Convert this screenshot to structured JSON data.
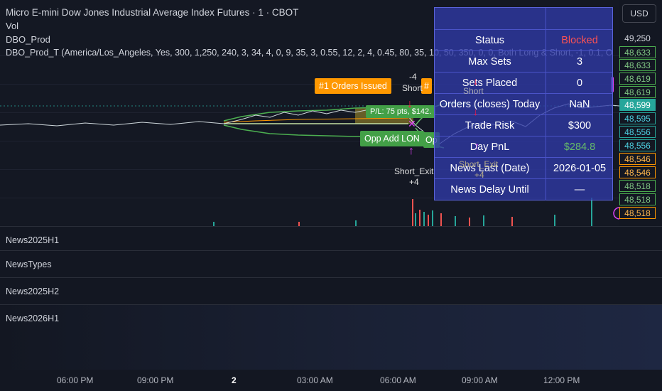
{
  "header": {
    "title": "Micro E-mini Dow Jones Industrial Average Index Futures · 1 · CBOT",
    "line2": "Vol",
    "line3": "DBO_Prod",
    "line4": "DBO_Prod_T (America/Los_Angeles, Yes, 300, 1,250, 240, 3, 34, 4, 0, 9, 35, 3, 0.55, 12, 2, 4, 0.45, 80, 35, 10, 50, 350, 0, 0, Both Long & Short, -1, 0.1, O"
  },
  "currency_button": "USD",
  "price_axis": {
    "top_price": "49,250",
    "tags": [
      {
        "text": "48,633",
        "style": "green"
      },
      {
        "text": "48,633",
        "style": "green"
      },
      {
        "text": "48,619",
        "style": "green"
      },
      {
        "text": "48,619",
        "style": "green"
      },
      {
        "text": "48,599",
        "style": "current"
      },
      {
        "text": "48,595",
        "style": "teal"
      },
      {
        "text": "48,556",
        "style": "teal"
      },
      {
        "text": "48,556",
        "style": "teal"
      },
      {
        "text": "48,546",
        "style": "orange"
      },
      {
        "text": "48,546",
        "style": "orange"
      },
      {
        "text": "48,518",
        "style": "green"
      },
      {
        "text": "48,518",
        "style": "green"
      },
      {
        "text": "48,518",
        "style": "orange"
      }
    ]
  },
  "status_table": {
    "rows": [
      {
        "key": "Status",
        "value": "Blocked",
        "value_color": "#ff5252"
      },
      {
        "key": "Max Sets",
        "value": "3",
        "value_color": "#ffffff"
      },
      {
        "key": "Sets Placed",
        "value": "0",
        "value_color": "#ffffff"
      },
      {
        "key": "Orders (closes) Today",
        "value": "NaN",
        "value_color": "#ffffff"
      },
      {
        "key": "Trade Risk",
        "value": "$300",
        "value_color": "#ffffff"
      },
      {
        "key": "Day PnL",
        "value": "$284.8",
        "value_color": "#66bb6a"
      },
      {
        "key": "News Last (Date)",
        "value": "2026-01-05",
        "value_color": "#ffffff"
      },
      {
        "key": "News Delay Until",
        "value": "—",
        "value_color": "#ffffff"
      }
    ]
  },
  "chart_labels": {
    "orders_issued": "#1 Orders Issued",
    "orders_issued_partial": "#",
    "pnl_label": "P/L: 75 pts, $142.",
    "opp_add": "Opp Add LON",
    "opp_add_partial": "Op",
    "short_top_count": "-4",
    "short_top": "Short",
    "short_mid": "Short",
    "short_exit": "Short_Exit",
    "short_exit_count": "+4",
    "short_exit_overlay": "Short_Exit",
    "short_exit_overlay_count": "+4"
  },
  "panes": [
    {
      "label": "News2025H1"
    },
    {
      "label": "NewsTypes"
    },
    {
      "label": "News2025H2"
    },
    {
      "label": "News2026H1"
    }
  ],
  "time_axis": {
    "labels": [
      {
        "text": "06:00 PM",
        "bold": false
      },
      {
        "text": "09:00 PM",
        "bold": false
      },
      {
        "text": "2",
        "bold": true
      },
      {
        "text": "03:00 AM",
        "bold": false
      },
      {
        "text": "06:00 AM",
        "bold": false
      },
      {
        "text": "09:00 AM",
        "bold": false
      },
      {
        "text": "12:00 PM",
        "bold": false
      }
    ]
  },
  "colors": {
    "background": "#131722",
    "table_bg": "#303aa8",
    "orange_label": "#ff9800",
    "green_label": "#4caf50",
    "magenta_marker": "#e040fb",
    "red_marker": "#ff1744"
  }
}
